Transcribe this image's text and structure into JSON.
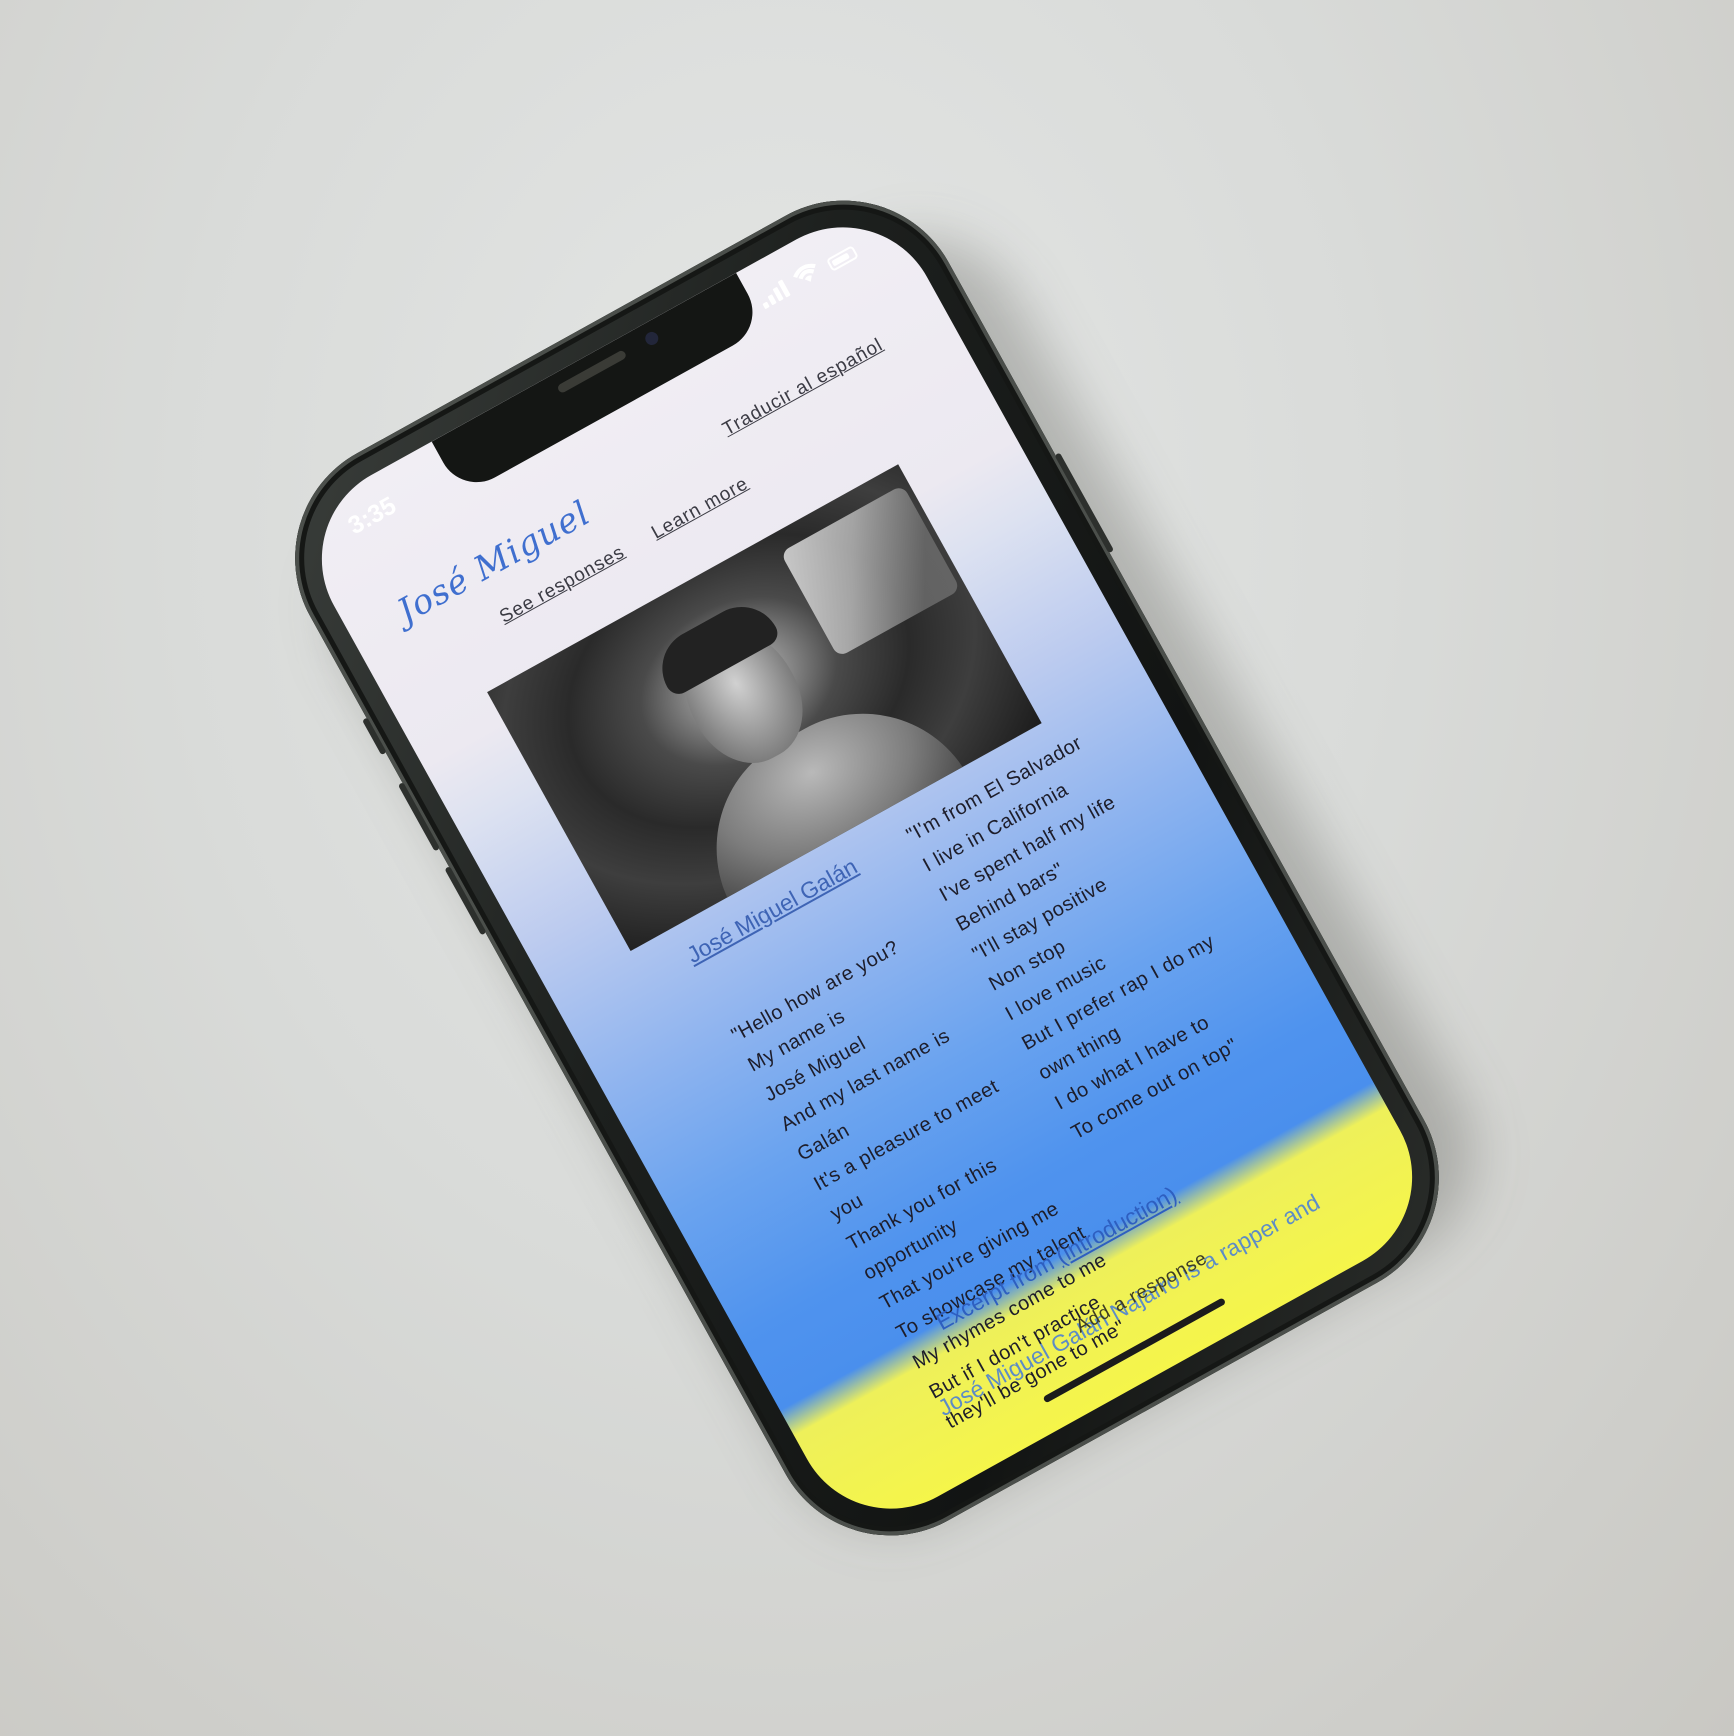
{
  "status_bar": {
    "time": "3:35",
    "icons": [
      "cellular-signal-icon",
      "wifi-icon",
      "battery-icon"
    ]
  },
  "site": {
    "logo": "José Miguel",
    "nav": {
      "see_responses": "See responses",
      "learn_more": "Learn more",
      "translate": "Traducir al español"
    }
  },
  "portrait": {
    "caption": "José Miguel Galán"
  },
  "verses": {
    "left": [
      "\"Hello how are you?",
      "My name is",
      "José Miguel",
      "And my last name is",
      "Galán",
      "It's a pleasure to meet",
      "you",
      "Thank you for this",
      "opportunity",
      "That you're giving me",
      "To showcase my talent",
      "To me my rhymes come to me",
      "My rhymes come to me",
      "But if I don't practice",
      "they'll be gone to me\""
    ],
    "right": [
      "\"I'm from El Salvador",
      "I live in California",
      "I've spent half my life",
      "Behind bars\"",
      "\"I'll stay positive",
      "Non stop",
      "I love music",
      "But I prefer rap I do my",
      "own thing",
      "I do what I have to",
      "To come out on top\""
    ]
  },
  "excerpt": {
    "prefix": "Excerpt from ",
    "link": "(introduction)"
  },
  "bio": {
    "text": "José Miguel Galán Najarro is a rapper and"
  },
  "footer": {
    "add_response": "Add a response"
  },
  "colors": {
    "background_top": "#f1eef4",
    "background_mid": "#4f93ee",
    "background_bottom": "#f5f54a",
    "link": "#3e64b5",
    "logo": "#3f6fcf"
  }
}
